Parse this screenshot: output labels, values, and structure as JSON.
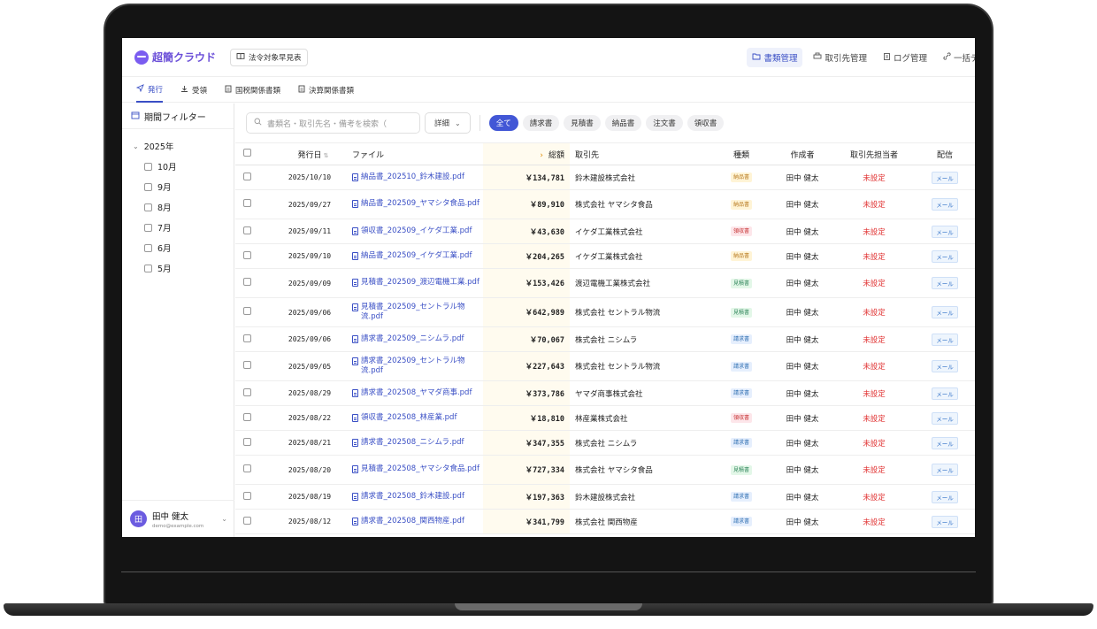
{
  "app": {
    "name": "超簡クラウド",
    "law_button": "法令対象早見表"
  },
  "nav": [
    {
      "label": "書類管理",
      "icon": "folder-icon",
      "active": true
    },
    {
      "label": "取引先管理",
      "icon": "printer-icon",
      "active": false
    },
    {
      "label": "ログ管理",
      "icon": "clipboard-icon",
      "active": false
    },
    {
      "label": "一括デー",
      "icon": "link-icon",
      "active": false
    }
  ],
  "tabs": [
    {
      "label": "発行",
      "icon": "send-icon",
      "active": true
    },
    {
      "label": "受領",
      "icon": "download-icon",
      "active": false
    },
    {
      "label": "国税関係書類",
      "icon": "document-icon",
      "active": false
    },
    {
      "label": "決算関係書類",
      "icon": "document-icon",
      "active": false
    }
  ],
  "sidebar": {
    "title": "期間フィルター",
    "year": "2025年",
    "months": [
      "10月",
      "9月",
      "8月",
      "7月",
      "6月",
      "5月"
    ],
    "user_name": "田中 健太",
    "user_email": "demo@example.com",
    "avatar_text": "田"
  },
  "filter": {
    "search_placeholder": "書類名・取引先名・備考を検索（",
    "detail_label": "詳細",
    "chips": [
      {
        "label": "全て",
        "active": true
      },
      {
        "label": "請求書",
        "active": false
      },
      {
        "label": "見積書",
        "active": false
      },
      {
        "label": "納品書",
        "active": false
      },
      {
        "label": "注文書",
        "active": false
      },
      {
        "label": "領収書",
        "active": false
      }
    ]
  },
  "table": {
    "columns": [
      "発行日",
      "ファイル",
      "総額",
      "取引先",
      "種類",
      "作成者",
      "取引先担当者",
      "配信"
    ],
    "sort_mark": "⇅",
    "amount_mark": "›",
    "badge_colors": {
      "納品書": {
        "bg": "#fff4d6",
        "fg": "#b7791f"
      },
      "領収書": {
        "bg": "#fde6ea",
        "fg": "#c53030"
      },
      "見積書": {
        "bg": "#e3f7e8",
        "fg": "#2f855a"
      },
      "請求書": {
        "bg": "#e6effd",
        "fg": "#2b6cb0"
      }
    },
    "rows": [
      {
        "date": "2025/10/10",
        "file": "納品書_202510_鈴木建設.pdf",
        "amount": "￥134,781",
        "client": "鈴木建設株式会社",
        "type": "納品書",
        "creator": "田中 健太",
        "contact": "未設定",
        "delivery": "メール"
      },
      {
        "date": "2025/09/27",
        "file": "納品書_202509_ヤマシタ食品.pdf",
        "amount": "￥89,910",
        "client": "株式会社 ヤマシタ食品",
        "type": "納品書",
        "creator": "田中 健太",
        "contact": "未設定",
        "delivery": "メール"
      },
      {
        "date": "2025/09/11",
        "file": "領収書_202509_イケダ工業.pdf",
        "amount": "￥43,630",
        "client": "イケダ工業株式会社",
        "type": "領収書",
        "creator": "田中 健太",
        "contact": "未設定",
        "delivery": "メール"
      },
      {
        "date": "2025/09/10",
        "file": "納品書_202509_イケダ工業.pdf",
        "amount": "￥204,265",
        "client": "イケダ工業株式会社",
        "type": "納品書",
        "creator": "田中 健太",
        "contact": "未設定",
        "delivery": "メール"
      },
      {
        "date": "2025/09/09",
        "file": "見積書_202509_渡辺電機工業.pdf",
        "amount": "￥153,426",
        "client": "渡辺電機工業株式会社",
        "type": "見積書",
        "creator": "田中 健太",
        "contact": "未設定",
        "delivery": "メール"
      },
      {
        "date": "2025/09/06",
        "file": "見積書_202509_セントラル物流.pdf",
        "amount": "￥642,989",
        "client": "株式会社 セントラル物流",
        "type": "見積書",
        "creator": "田中 健太",
        "contact": "未設定",
        "delivery": "メール"
      },
      {
        "date": "2025/09/06",
        "file": "請求書_202509_ニシムラ.pdf",
        "amount": "￥70,067",
        "client": "株式会社 ニシムラ",
        "type": "請求書",
        "creator": "田中 健太",
        "contact": "未設定",
        "delivery": "メール"
      },
      {
        "date": "2025/09/05",
        "file": "請求書_202509_セントラル物流.pdf",
        "amount": "￥227,643",
        "client": "株式会社 セントラル物流",
        "type": "請求書",
        "creator": "田中 健太",
        "contact": "未設定",
        "delivery": "メール"
      },
      {
        "date": "2025/08/29",
        "file": "請求書_202508_ヤマダ商事.pdf",
        "amount": "￥373,786",
        "client": "ヤマダ商事株式会社",
        "type": "請求書",
        "creator": "田中 健太",
        "contact": "未設定",
        "delivery": "メール"
      },
      {
        "date": "2025/08/22",
        "file": "領収書_202508_林産業.pdf",
        "amount": "￥18,810",
        "client": "林産業株式会社",
        "type": "領収書",
        "creator": "田中 健太",
        "contact": "未設定",
        "delivery": "メール"
      },
      {
        "date": "2025/08/21",
        "file": "請求書_202508_ニシムラ.pdf",
        "amount": "￥347,355",
        "client": "株式会社 ニシムラ",
        "type": "請求書",
        "creator": "田中 健太",
        "contact": "未設定",
        "delivery": "メール"
      },
      {
        "date": "2025/08/20",
        "file": "見積書_202508_ヤマシタ食品.pdf",
        "amount": "￥727,334",
        "client": "株式会社 ヤマシタ食品",
        "type": "見積書",
        "creator": "田中 健太",
        "contact": "未設定",
        "delivery": "メール"
      },
      {
        "date": "2025/08/19",
        "file": "請求書_202508_鈴木建設.pdf",
        "amount": "￥197,363",
        "client": "鈴木建設株式会社",
        "type": "請求書",
        "creator": "田中 健太",
        "contact": "未設定",
        "delivery": "メール"
      },
      {
        "date": "2025/08/12",
        "file": "請求書_202508_関西物産.pdf",
        "amount": "￥341,799",
        "client": "株式会社 関西物産",
        "type": "請求書",
        "creator": "田中 健太",
        "contact": "未設定",
        "delivery": "メール"
      }
    ]
  }
}
